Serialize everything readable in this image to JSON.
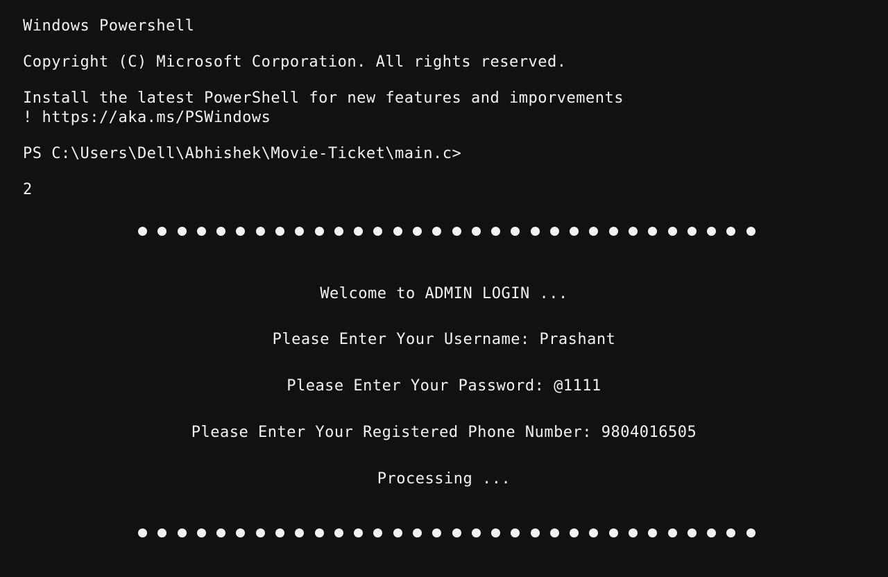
{
  "terminal": {
    "header_title": "Windows Powershell",
    "copyright": "Copyright (C) Microsoft Corporation. All rights reserved.",
    "install_line1": "Install the latest PowerShell for new features and imporvements",
    "install_line2": "! https://aka.ms/PSWindows",
    "prompt": "PS C:\\Users\\Dell\\Abhishek\\Movie-Ticket\\main.c>",
    "input_value": "2",
    "separator_dot_count": 32,
    "welcome": "Welcome to ADMIN LOGIN ...",
    "username_line": "Please Enter Your Username: Prashant",
    "password_line": "Please Enter Your Password: @1111",
    "phone_line": "Please Enter Your Registered Phone Number: 9804016505",
    "processing": "Processing ..."
  },
  "colors": {
    "background": "#111111",
    "text": "#f2f2f2"
  }
}
